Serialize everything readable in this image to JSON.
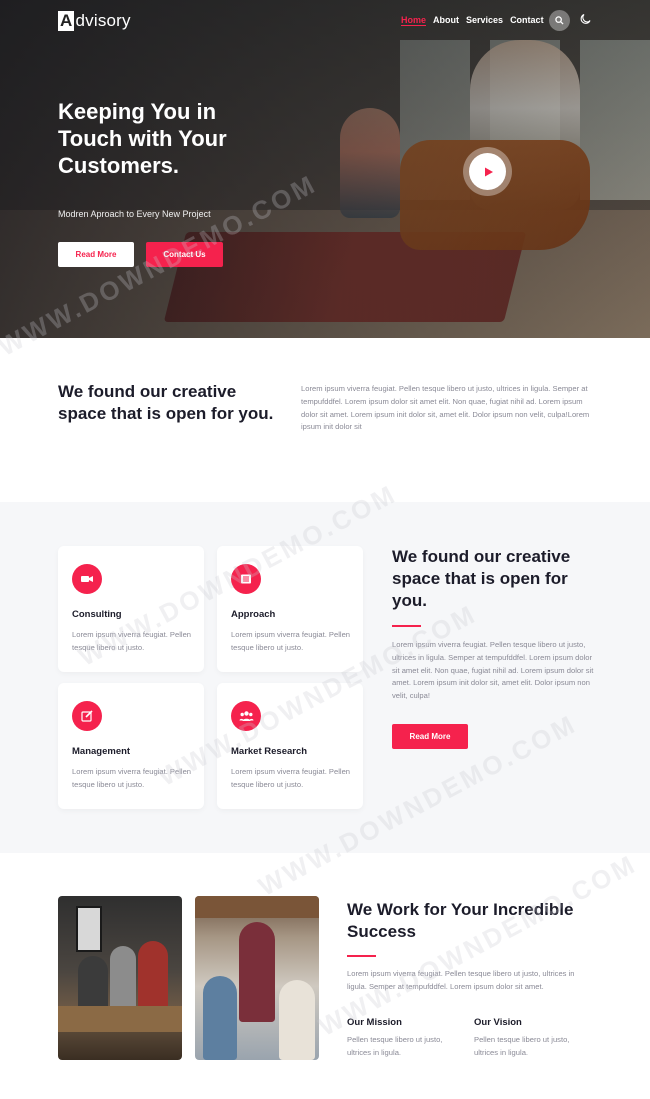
{
  "brand": {
    "logo_mark": "A",
    "logo_rest": "dvisory"
  },
  "nav": {
    "items": [
      "Home",
      "About",
      "Services",
      "Contact"
    ],
    "active": "Home"
  },
  "hero": {
    "title": "Keeping You in Touch with Your Customers.",
    "subtitle": "Modren Aproach to Every New Project",
    "primary_button": "Read More",
    "secondary_button": "Contact Us"
  },
  "intro": {
    "title": "We found our creative space that is open for you.",
    "text": "Lorem ipsum viverra feugiat. Pellen tesque libero ut justo, ultrices in ligula. Semper at tempufddfel. Lorem ipsum dolor sit amet elit. Non quae, fugiat nihil ad. Lorem ipsum dolor sit amet. Lorem ipsum init dolor sit, amet elit. Dolor ipsum non velit, culpa!Lorem ipsum init dolor sit"
  },
  "services": {
    "cards": [
      {
        "icon": "video-camera-icon",
        "title": "Consulting",
        "text": "Lorem ipsum viverra feugiat. Pellen tesque libero ut justo."
      },
      {
        "icon": "list-icon",
        "title": "Approach",
        "text": "Lorem ipsum viverra feugiat. Pellen tesque libero ut justo."
      },
      {
        "icon": "edit-icon",
        "title": "Management",
        "text": "Lorem ipsum viverra feugiat. Pellen tesque libero ut justo."
      },
      {
        "icon": "users-icon",
        "title": "Market Research",
        "text": "Lorem ipsum viverra feugiat. Pellen tesque libero ut justo."
      }
    ],
    "title": "We found our creative space that is open for you.",
    "text": "Lorem ipsum viverra feugiat. Pellen tesque libero ut justo, ultrices in ligula. Semper at tempufddfel. Lorem ipsum dolor sit amet elit. Non quae, fugiat nihil ad. Lorem ipsum dolor sit amet. Lorem ipsum init dolor sit, amet elit. Dolor ipsum non velit, culpa!",
    "button": "Read More"
  },
  "about": {
    "title": "We Work for Your Incredible Success",
    "text": "Lorem ipsum viverra feugiat. Pellen tesque libero ut justo, ultrices in ligula. Semper at tempufddfel. Lorem ipsum dolor sit amet.",
    "mission_title": "Our Mission",
    "mission_text": "Pellen tesque libero ut justo, ultrices in ligula.",
    "vision_title": "Our Vision",
    "vision_text": "Pellen tesque libero ut justo, ultrices in ligula."
  },
  "watermark": "WWW.DOWNDEMO.COM",
  "colors": {
    "accent": "#f5224d",
    "heading": "#1c1c2a",
    "body_text": "#8a8a96",
    "section_bg": "#f6f7f9"
  }
}
